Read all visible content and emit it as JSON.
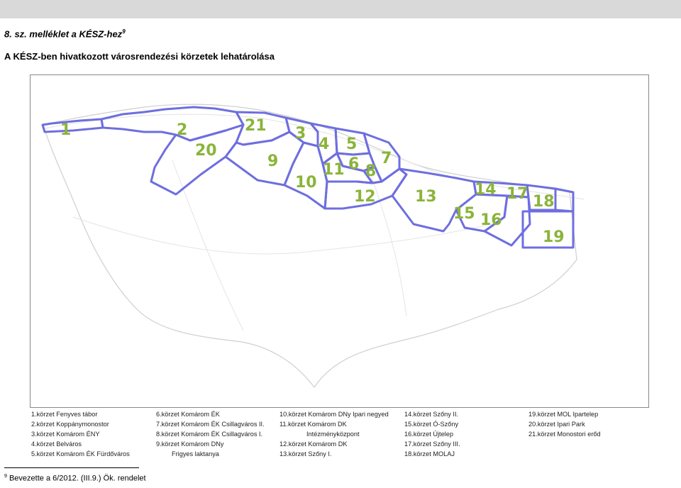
{
  "document": {
    "annex_label": "8. sz. melléklet a KÉSZ-hez",
    "annex_footnote_mark": "9",
    "title": "A KÉSZ-ben hivatkozott városrendezési körzetek lehatárolása"
  },
  "map": {
    "boundary_color": "#6e6ee0",
    "label_color": "#8ab43a",
    "district_labels": [
      "1",
      "2",
      "3",
      "4",
      "5",
      "6",
      "7",
      "8",
      "9",
      "10",
      "11",
      "12",
      "13",
      "14",
      "15",
      "16",
      "17",
      "18",
      "19",
      "20",
      "21"
    ]
  },
  "legend": {
    "col1": [
      "1.körzet Fenyves tábor",
      "2.körzet Koppánymonostor",
      "3.körzet Komárom ÉNY",
      "4.körzet Belváros",
      "5.körzet Komárom ÉK Fürdőváros"
    ],
    "col2": [
      "6.körzet Komárom ÉK",
      "7.körzet Komárom ÉK Csillagváros II.",
      "8.körzet Komárom ÉK Csillagváros I.",
      "9.körzet Komárom DNy",
      "Frigyes laktanya"
    ],
    "col3": [
      "10.körzet Komárom DNy Ipari negyed",
      "11.körzet Komárom DK",
      "Intézményközpont",
      "12.körzet Komárom DK",
      "13.körzet Szőny I."
    ],
    "col4": [
      "14.körzet Szőny II.",
      "15.körzet Ó-Szőny",
      "16.körzet Újtelep",
      "17.körzet Szőny III.",
      "18.körzet MOLAJ"
    ],
    "col5": [
      "19.körzet MOL Ipartelep",
      "20.körzet Ipari Park",
      "21.körzet Monostori erőd"
    ]
  },
  "footnote": {
    "mark": "9",
    "text": " Bevezette a 6/2012. (III.9.) Ök. rendelet"
  }
}
